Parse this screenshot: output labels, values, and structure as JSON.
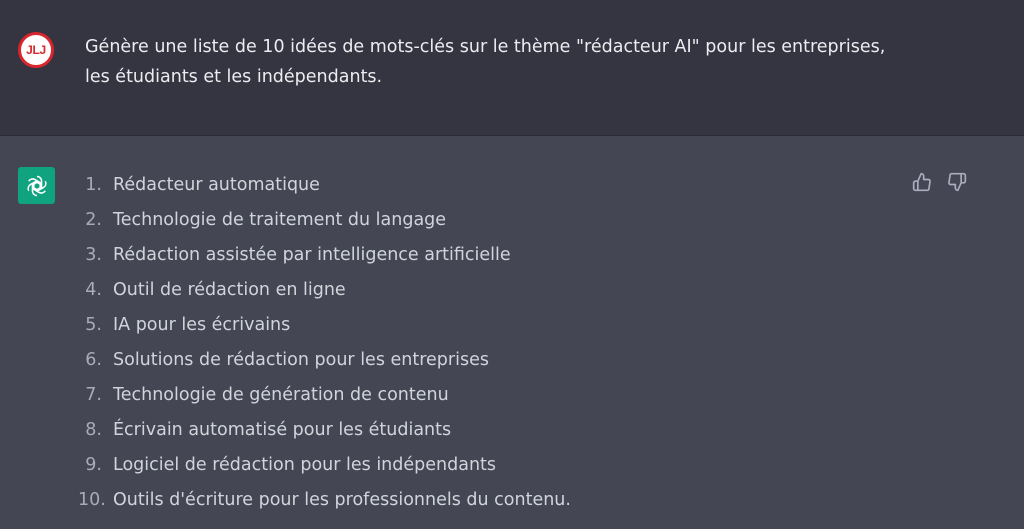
{
  "user_message": {
    "avatar_initials": "JLJ",
    "text": "Génère une liste de 10 idées de mots-clés sur le thème \"rédacteur AI\" pour les entreprises, les étudiants et les indépendants."
  },
  "assistant_message": {
    "avatar_icon": "openai-logo-icon",
    "items": [
      {
        "num": "1.",
        "text": "Rédacteur automatique"
      },
      {
        "num": "2.",
        "text": "Technologie de traitement du langage"
      },
      {
        "num": "3.",
        "text": "Rédaction assistée par intelligence artificielle"
      },
      {
        "num": "4.",
        "text": "Outil de rédaction en ligne"
      },
      {
        "num": "5.",
        "text": "IA pour les écrivains"
      },
      {
        "num": "6.",
        "text": "Solutions de rédaction pour les entreprises"
      },
      {
        "num": "7.",
        "text": "Technologie de génération de contenu"
      },
      {
        "num": "8.",
        "text": "Écrivain automatisé pour les étudiants"
      },
      {
        "num": "9.",
        "text": "Logiciel de rédaction pour les indépendants"
      },
      {
        "num": "10.",
        "text": "Outils d'écriture pour les professionnels du contenu."
      }
    ],
    "feedback_icons": [
      "thumbs-up-icon",
      "thumbs-down-icon"
    ]
  },
  "colors": {
    "user_row_bg": "#343541",
    "assistant_row_bg": "#444654",
    "avatar_ring": "#d9262c",
    "gpt_logo_bg": "#10a37f",
    "text": "#ececf1",
    "list_text": "#d1d5db"
  }
}
